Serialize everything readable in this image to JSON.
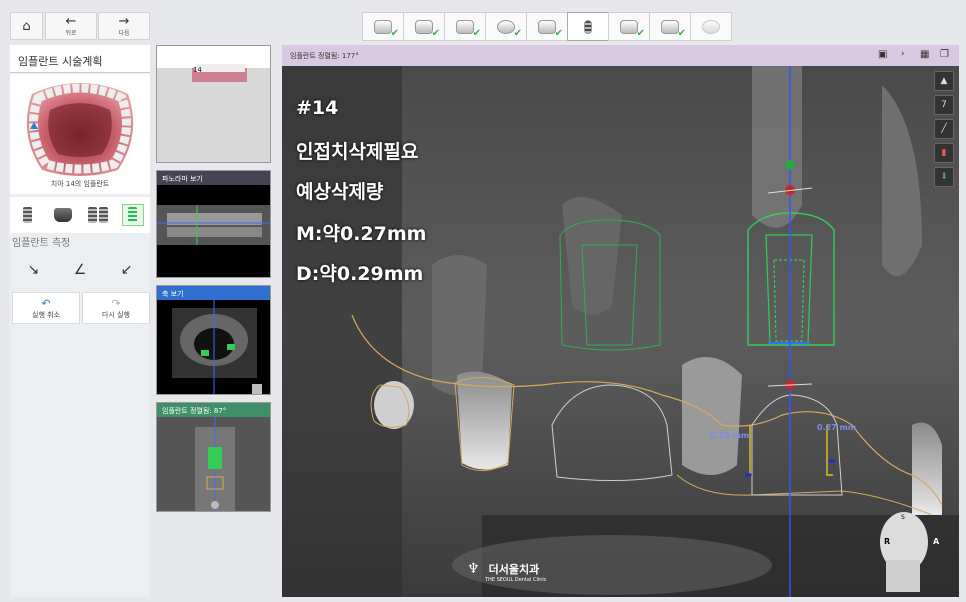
{
  "toolbar": {
    "home_icon": "home-icon",
    "back_label": "뒤로",
    "next_label": "다음",
    "steps": [
      {
        "icon": "ct-scan-icon",
        "done": true
      },
      {
        "icon": "data-import-icon",
        "done": true
      },
      {
        "icon": "nerve-tracing-icon",
        "done": true
      },
      {
        "icon": "crown-icon",
        "done": true
      },
      {
        "icon": "arch-icon",
        "done": true
      },
      {
        "icon": "implant-icon",
        "done": false,
        "active": true
      },
      {
        "icon": "sleeve-icon",
        "done": true
      },
      {
        "icon": "guide-icon",
        "done": true
      },
      {
        "icon": "export-icon",
        "done": false
      }
    ]
  },
  "left_panel": {
    "title": "임플란트 시술계획",
    "model_caption": "치아 14의 임플란트",
    "measure_section": "임플란트 측정",
    "undo_label": "실행 취소",
    "redo_label": "다시 실행"
  },
  "thumbnails": {
    "top_tooth_label": "14",
    "panorama_title": "파노라마 보기",
    "axial_title": "축 보기",
    "implant_view_title": "임플란트 정렬됨: 87°"
  },
  "main_view": {
    "header": "임플란트 정렬됨: 177°",
    "overlay_lines": [
      "#14",
      "인접치삭제필요",
      "예상삭제량",
      "M:약0.27mm",
      "D:약0.29mm"
    ],
    "measure_left": "0.29 mm",
    "measure_right": "0.27 mm",
    "orientation_r": "R",
    "orientation_a": "A",
    "orientation_s": "S",
    "logo_name": "더서울치과",
    "logo_sub": "THE SEOUL Dental Clinic"
  },
  "colors": {
    "accent": "#2d7dd6",
    "check": "#3bb14a",
    "implant_outline": "#33cc55",
    "bone_outline": "#d4a860",
    "measure": "#7a8aee",
    "axis": "#3355ff"
  }
}
